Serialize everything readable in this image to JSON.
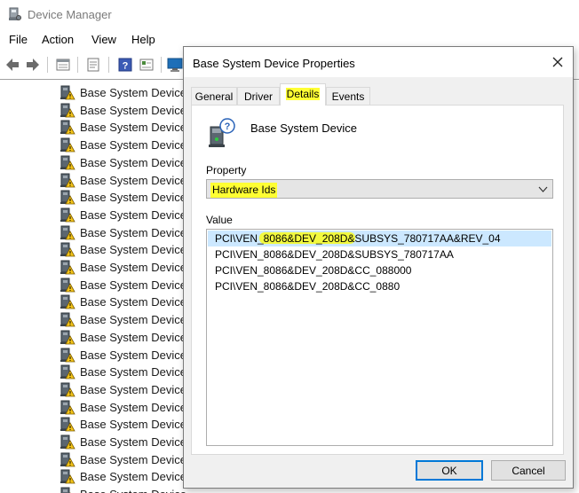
{
  "main_window": {
    "title": "Device Manager",
    "menu": [
      "File",
      "Action",
      "View",
      "Help"
    ],
    "toolbar_icons": [
      "back-arrow-icon",
      "forward-arrow-icon",
      "device-view-icon",
      "properties-icon",
      "help-icon",
      "resources-view-icon",
      "monitor-icon"
    ],
    "tree_items": [
      "Base System Device",
      "Base System Device",
      "Base System Device",
      "Base System Device",
      "Base System Device",
      "Base System Device",
      "Base System Device",
      "Base System Device",
      "Base System Device",
      "Base System Device",
      "Base System Device",
      "Base System Device",
      "Base System Device",
      "Base System Device",
      "Base System Device",
      "Base System Device",
      "Base System Device",
      "Base System Device",
      "Base System Device",
      "Base System Device",
      "Base System Device",
      "Base System Device",
      "Base System Device",
      "Base System Device"
    ]
  },
  "dialog": {
    "title": "Base System Device Properties",
    "tabs": [
      "General",
      "Driver",
      "Details",
      "Events"
    ],
    "active_tab": "Details",
    "device_name": "Base System Device",
    "property_label": "Property",
    "property_selected": "Hardware Ids",
    "value_label": "Value",
    "values": [
      "PCI\\VEN_8086&DEV_208D&SUBSYS_780717AA&REV_04",
      "PCI\\VEN_8086&DEV_208D&SUBSYS_780717AA",
      "PCI\\VEN_8086&DEV_208D&CC_088000",
      "PCI\\VEN_8086&DEV_208D&CC_0880"
    ],
    "ok_label": "OK",
    "cancel_label": "Cancel"
  },
  "colors": {
    "highlight": "#ffff33",
    "selection": "#cce8ff",
    "default_button_border": "#0078d7"
  }
}
